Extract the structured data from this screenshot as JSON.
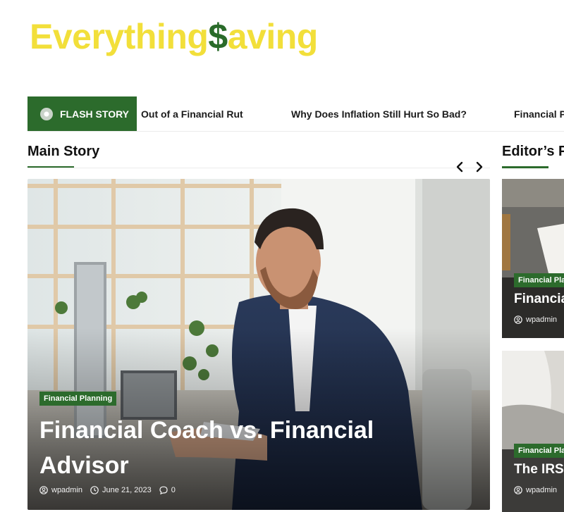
{
  "site": {
    "logo_part1": "Everything",
    "logo_dollar": "$",
    "logo_part2": "aving",
    "colors": {
      "logo_yellow": "#f2df3a",
      "brand_green": "#2c6b2c"
    }
  },
  "ticker": {
    "label": "FLASH STORY",
    "items": [
      "Out of a Financial Rut",
      "Why Does Inflation Still Hurt So Bad?",
      "Financial P"
    ]
  },
  "main_story": {
    "section_title": "Main Story",
    "category": "Financial Planning",
    "title": "Financial Coach vs. Financial Advisor",
    "author": "wpadmin",
    "date": "June 21, 2023",
    "comments": "0"
  },
  "editors_picks": {
    "section_title": "Editor’s P",
    "cards": [
      {
        "category": "Financial Pla",
        "title": "Financia",
        "author": "wpadmin"
      },
      {
        "category": "Financial Pla",
        "title": "The IRS s",
        "author": "wpadmin"
      }
    ]
  }
}
